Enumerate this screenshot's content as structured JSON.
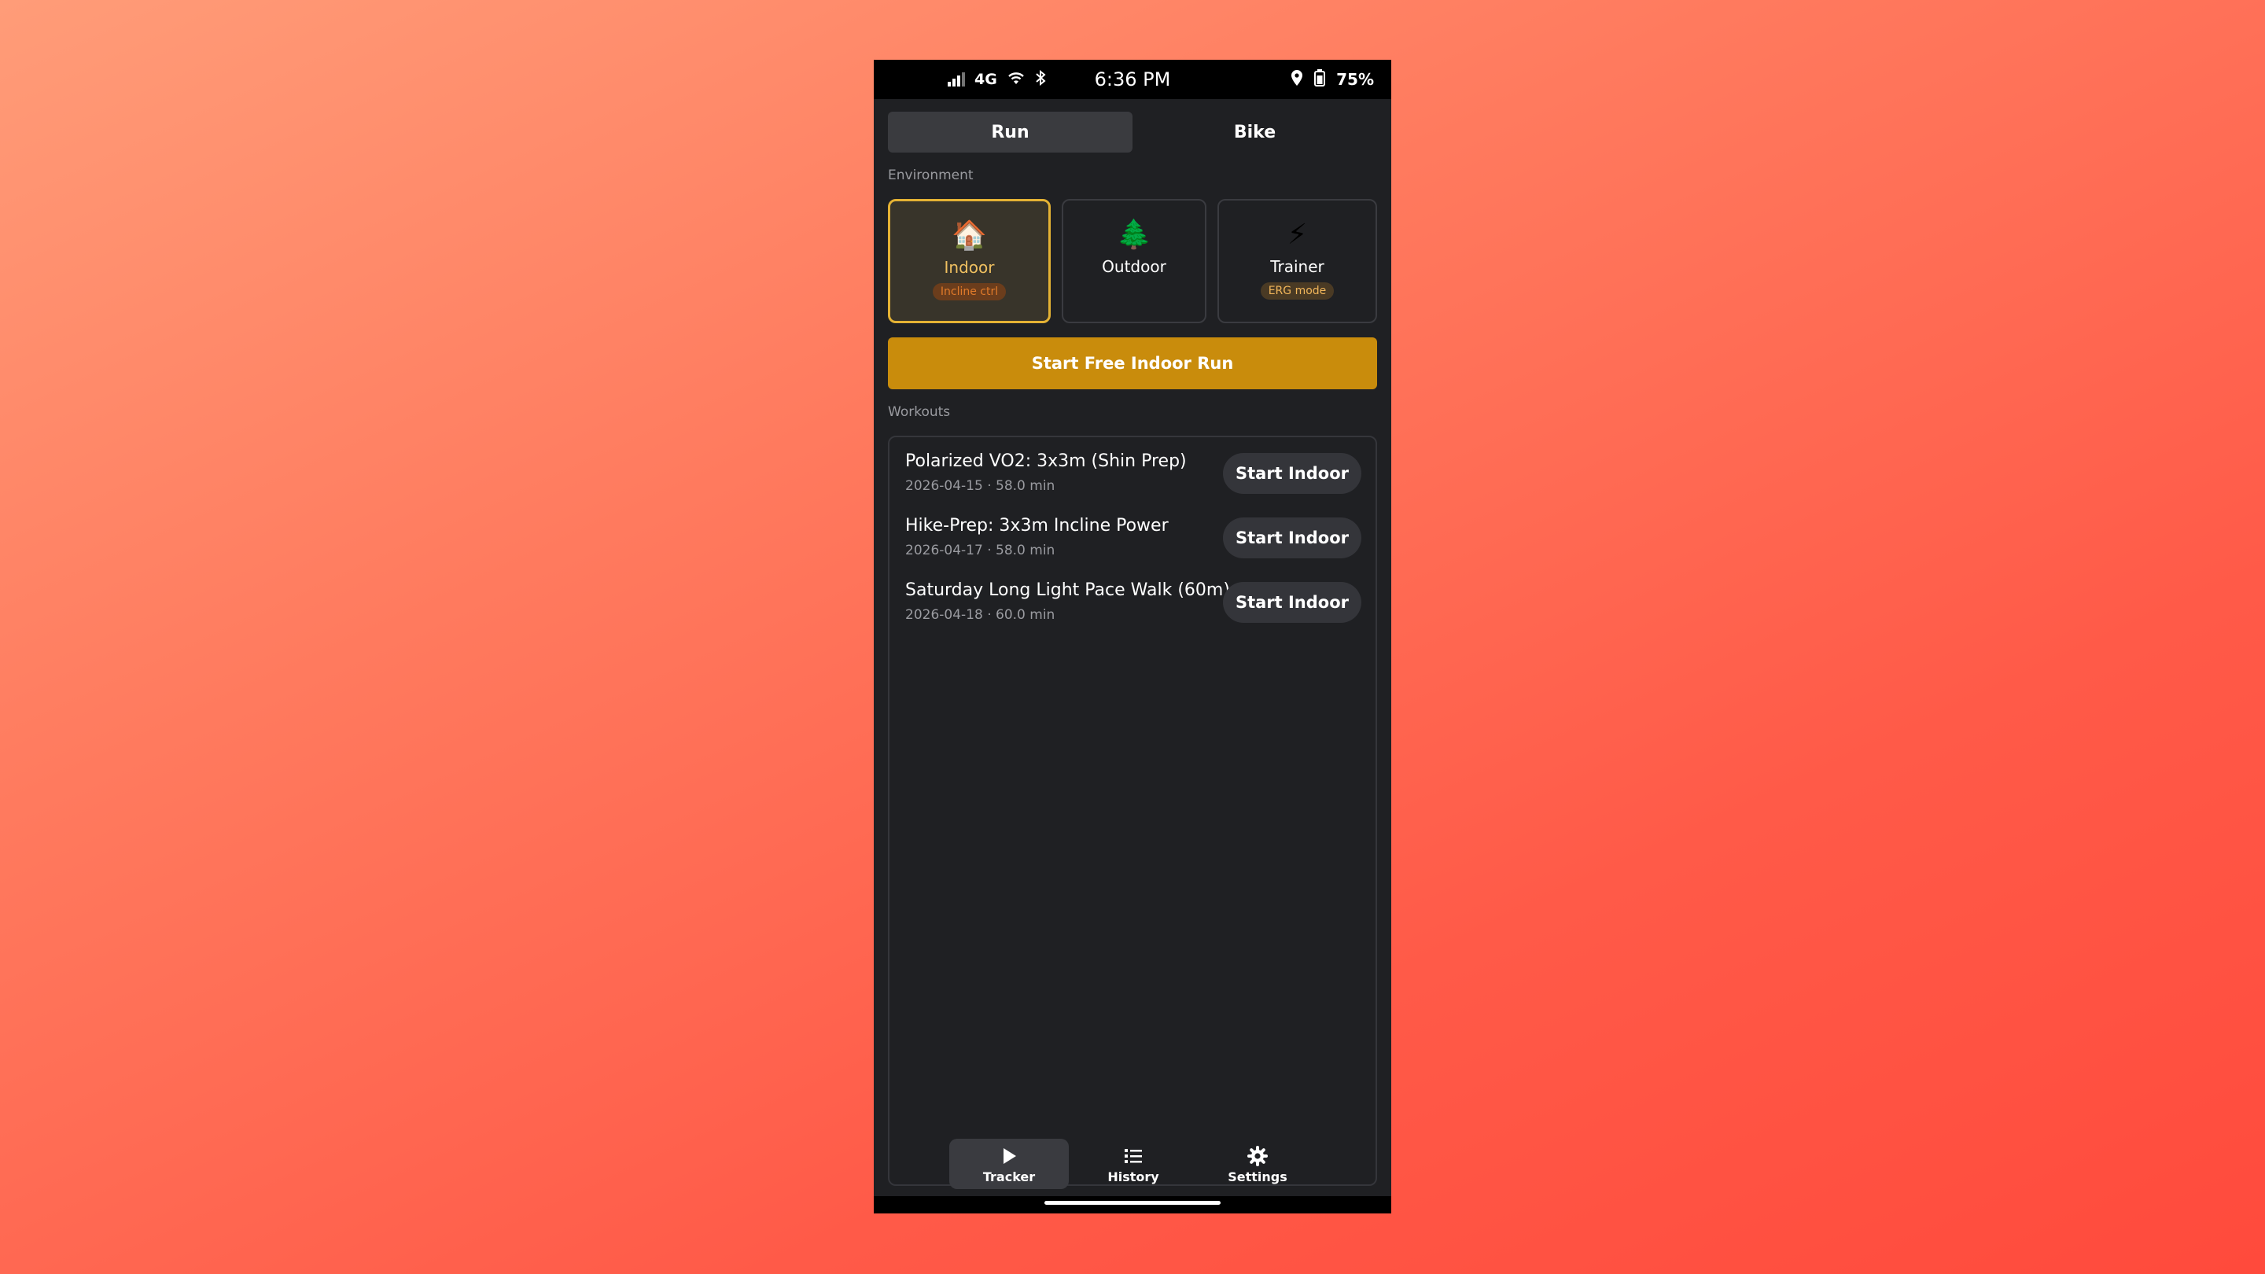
{
  "status_bar": {
    "network": "4G",
    "time": "6:36 PM",
    "battery": "75%"
  },
  "tabs": [
    {
      "label": "Run",
      "active": true
    },
    {
      "label": "Bike",
      "active": false
    }
  ],
  "environment": {
    "section_label": "Environment",
    "options": [
      {
        "icon": "🏠",
        "icon_name": "house-icon",
        "name": "Indoor",
        "badge": "Incline ctrl",
        "selected": true
      },
      {
        "icon": "🌲",
        "icon_name": "tree-icon",
        "name": "Outdoor",
        "badge": "",
        "selected": false
      },
      {
        "icon": "⚡",
        "icon_name": "lightning-icon",
        "name": "Trainer",
        "badge": "ERG mode",
        "selected": false
      }
    ]
  },
  "primary_action": {
    "label": "Start Free Indoor Run"
  },
  "workouts": {
    "section_label": "Workouts",
    "items": [
      {
        "title": "Polarized VO2: 3x3m (Shin Prep)",
        "meta": "2026-04-15 · 58.0 min",
        "button": "Start Indoor"
      },
      {
        "title": "Hike-Prep: 3x3m Incline Power",
        "meta": "2026-04-17 · 58.0 min",
        "button": "Start Indoor"
      },
      {
        "title": "Saturday Long Light Pace Walk (60m)",
        "meta": "2026-04-18 · 60.0 min",
        "button": "Start Indoor"
      }
    ]
  },
  "bottom_nav": [
    {
      "label": "Tracker",
      "icon": "play-icon",
      "active": true
    },
    {
      "label": "History",
      "icon": "list-icon",
      "active": false
    },
    {
      "label": "Settings",
      "icon": "gear-icon",
      "active": false
    }
  ],
  "colors": {
    "accent": "#c98c0c",
    "selected_border": "#e4b234",
    "background": "#1f2023"
  }
}
